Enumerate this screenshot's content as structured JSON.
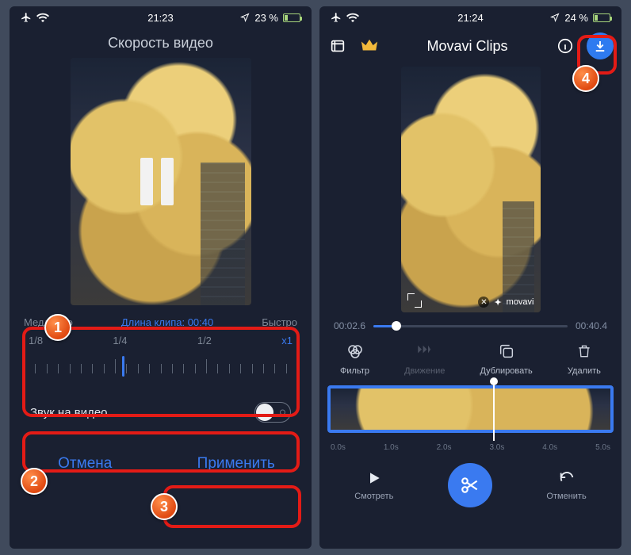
{
  "left": {
    "status": {
      "time": "21:23",
      "battery": "23 %"
    },
    "title": "Скорость видео",
    "slow_label": "Медленно",
    "fast_label": "Быстро",
    "clip_length_label": "Длина клипа: 00:40",
    "speeds": {
      "s1": "1/8",
      "s2": "1/4",
      "s3": "1/2",
      "s4": "x1"
    },
    "sound_label": "Звук на видео",
    "cancel": "Отмена",
    "apply": "Применить"
  },
  "right": {
    "status": {
      "time": "21:24",
      "battery": "24 %"
    },
    "app_title": "Movavi Clips",
    "watermark": "movavi",
    "time_current": "00:02.6",
    "time_total": "00:40.4",
    "tools": {
      "filter": "Фильтр",
      "motion": "Движение",
      "duplicate": "Дублировать",
      "delete": "Удалить"
    },
    "ticks": {
      "t0": "0.0s",
      "t1": "1.0s",
      "t2": "2.0s",
      "t3": "3.0s",
      "t4": "4.0s",
      "t5": "5.0s"
    },
    "bottom": {
      "watch": "Смотреть",
      "undo": "Отменить"
    }
  },
  "badges": {
    "b1": "1",
    "b2": "2",
    "b3": "3",
    "b4": "4"
  }
}
